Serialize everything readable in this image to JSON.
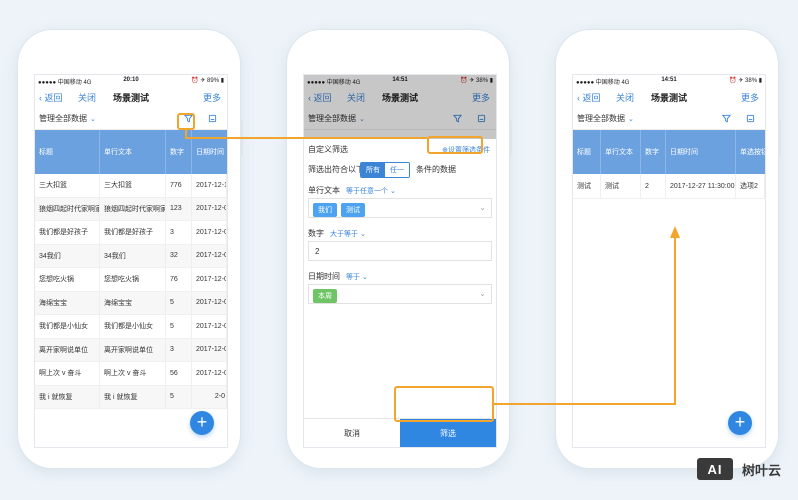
{
  "status": {
    "signal": "●●●●● 中国移动 4G",
    "battery_1": "⏰ ✈ 89% ▮",
    "battery_2": "⏰ ✈ 38% ▮",
    "time_1": "20:10",
    "time_2": "14:51"
  },
  "nav": {
    "back": "返回",
    "close": "关闭",
    "title": "场景测试",
    "more": "更多"
  },
  "toolbar": {
    "manage": "管理全部数据"
  },
  "list_table": {
    "columns": [
      "标题",
      "单行文本",
      "数字",
      "日期时间"
    ],
    "rows": [
      [
        "三大扣篮",
        "三大扣篮",
        "776",
        "2017-12-1"
      ],
      [
        "狼烟四起时代家啊家",
        "狼烟四起时代家啊家",
        "123",
        "2017-12-0"
      ],
      [
        "我们都是好孩子",
        "我们都是好孩子",
        "3",
        "2017-12-0"
      ],
      [
        "34我们",
        "34我们",
        "32",
        "2017-12-0"
      ],
      [
        "您想吃火锅",
        "您想吃火锅",
        "76",
        "2017-12-0"
      ],
      [
        "海绵宝宝",
        "海绵宝宝",
        "5",
        "2017-12-0"
      ],
      [
        "我们都是小仙女",
        "我们都是小仙女",
        "5",
        "2017-12-0"
      ],
      [
        "离开家啊说单位",
        "离开家啊说单位",
        "3",
        "2017-12-0"
      ],
      [
        "啊上次 v 奋斗",
        "啊上次 v 奋斗",
        "56",
        "2017-12-0"
      ],
      [
        "我 i 就恢复",
        "我 i 就恢复",
        "5",
        "2-0"
      ]
    ]
  },
  "filter": {
    "custom_label": "自定义筛选",
    "set_conditions": "⊕设置筛选条件",
    "match_prefix": "筛选出符合以下",
    "match_all": "所有",
    "match_any": "任一",
    "match_suffix": "条件的数据",
    "f1_label": "单行文本",
    "f1_op": "等于任意一个 ⌄",
    "f1_tags": [
      "我们",
      "测试"
    ],
    "f2_label": "数字",
    "f2_op": "大于等于 ⌄",
    "f2_value": "2",
    "f3_label": "日期时间",
    "f3_op": "等于 ⌄",
    "f3_tag": "本周",
    "cancel": "取消",
    "confirm": "筛选"
  },
  "result_table": {
    "columns": [
      "标题",
      "单行文本",
      "数字",
      "日期时间",
      "单选按钮"
    ],
    "rows": [
      [
        "测试",
        "测试",
        "2",
        "2017-12-27 11:30:00",
        "选项2"
      ]
    ]
  },
  "brand": {
    "logo": "AI",
    "name": "树叶云"
  },
  "colors": {
    "accent": "#3b84d6",
    "header": "#6ba1de",
    "highlight": "#f2a52c",
    "fab": "#2f87e2"
  }
}
